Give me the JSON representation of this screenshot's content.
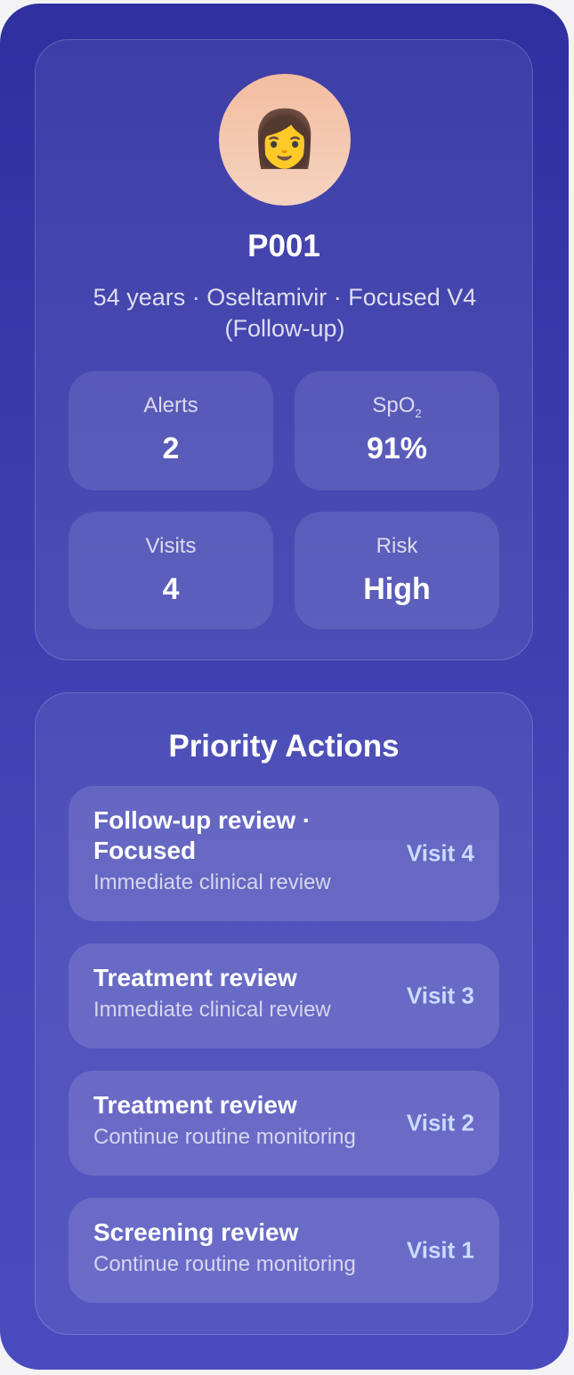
{
  "patient": {
    "avatar_emoji": "👩",
    "avatar_icon": "woman-avatar-icon",
    "id": "P001",
    "meta": "54 years · Oseltamivir · Focused V4 (Follow-up)"
  },
  "stats": {
    "alerts": {
      "label": "Alerts",
      "value": "2"
    },
    "spo2": {
      "label_main": "SpO",
      "label_sub": "2",
      "value": "91%"
    },
    "visits": {
      "label": "Visits",
      "value": "4"
    },
    "risk": {
      "label": "Risk",
      "value": "High"
    }
  },
  "priority": {
    "title": "Priority Actions",
    "items": [
      {
        "title": "Follow-up review · Focused",
        "subtitle": "Immediate clinical review",
        "visit": "Visit 4"
      },
      {
        "title": "Treatment review",
        "subtitle": "Immediate clinical review",
        "visit": "Visit 3"
      },
      {
        "title": "Treatment review",
        "subtitle": "Continue routine monitoring",
        "visit": "Visit 2"
      },
      {
        "title": "Screening review",
        "subtitle": "Continue routine monitoring",
        "visit": "Visit 1"
      }
    ]
  },
  "colors": {
    "background_top": "#2f2fa0",
    "background_bottom": "#4a4bbd",
    "visit_accent": "#c9dcff",
    "avatar_bg": "#f3bda0"
  }
}
